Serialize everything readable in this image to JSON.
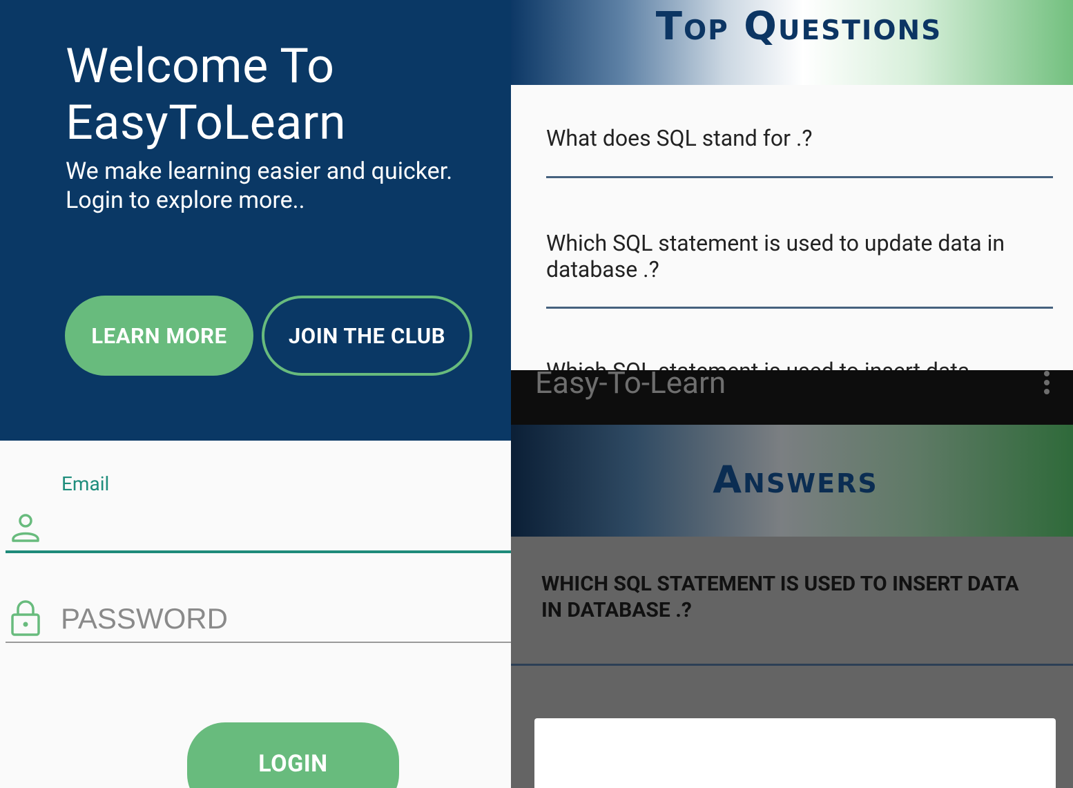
{
  "login": {
    "welcome_title": "Welcome To EasyToLearn",
    "welcome_subtitle": "We make learning easier and quicker. Login to explore more..",
    "learn_more_label": "LEARN MORE",
    "join_club_label": "JOIN THE CLUB",
    "email_label": "Email",
    "email_value": "",
    "password_placeholder": "PASSWORD",
    "login_label": "LOGIN"
  },
  "questions": {
    "title": "Top Questions",
    "items": [
      {
        "text": "What does SQL stand for .?"
      },
      {
        "text": "Which SQL statement is used to update data in database .?"
      },
      {
        "text": "Which SQL statement is used to insert data"
      }
    ]
  },
  "answers": {
    "app_title": "Easy-To-Learn",
    "title": "Answers",
    "question": "Which SQL statement is used to insert data in database .?"
  },
  "colors": {
    "hero_navy": "#0a3865",
    "accent_green": "#68bb7d",
    "email_teal": "#1e8d7c",
    "dim_overlay": "#646464"
  },
  "icons": {
    "email": "person-icon",
    "password": "lock-icon",
    "app_menu": "overflow-menu-icon"
  }
}
